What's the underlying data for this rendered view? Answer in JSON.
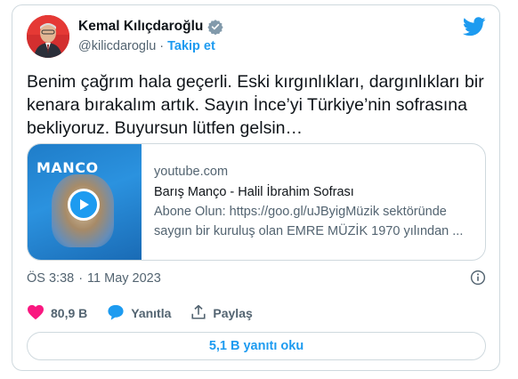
{
  "author": {
    "name": "Kemal Kılıçdaroğlu",
    "handle": "@kilicdaroglu",
    "separator": "·",
    "follow_label": "Takip et",
    "avatar_icon": "avatar-photo",
    "verified_icon": "verified-badge-icon"
  },
  "tweet": {
    "text_lines": [
      "Benim çağrım hala geçerli. Eski kırgınlıkları, dargınlıkları bir",
      "kenara bırakalım artık. Sayın İnce’yi Türkiye’nin sofrasına",
      "bekliyoruz. Buyursun lütfen gelsin…"
    ]
  },
  "link_card": {
    "thumbnail_title": "MANCO",
    "domain": "youtube.com",
    "title": "Barış Manço - Halil İbrahim Sofrası",
    "description_lines": [
      "Abone Olun: https://goo.gl/uJByigMüzik sektöründe",
      "saygın bir kuruluş olan EMRE MÜZİK 1970 yılından ..."
    ]
  },
  "meta": {
    "time": "ÖS 3:38",
    "separator": "·",
    "date": "11 May 2023"
  },
  "actions": {
    "likes": "80,9 B",
    "reply_label": "Yanıtla",
    "share_label": "Paylaş"
  },
  "replies_button": "5,1 B yanıtı oku",
  "colors": {
    "accent": "#1d9bf0",
    "like": "#f91880",
    "text": "#0f1419",
    "muted": "#536471",
    "border": "#cfd9de"
  }
}
